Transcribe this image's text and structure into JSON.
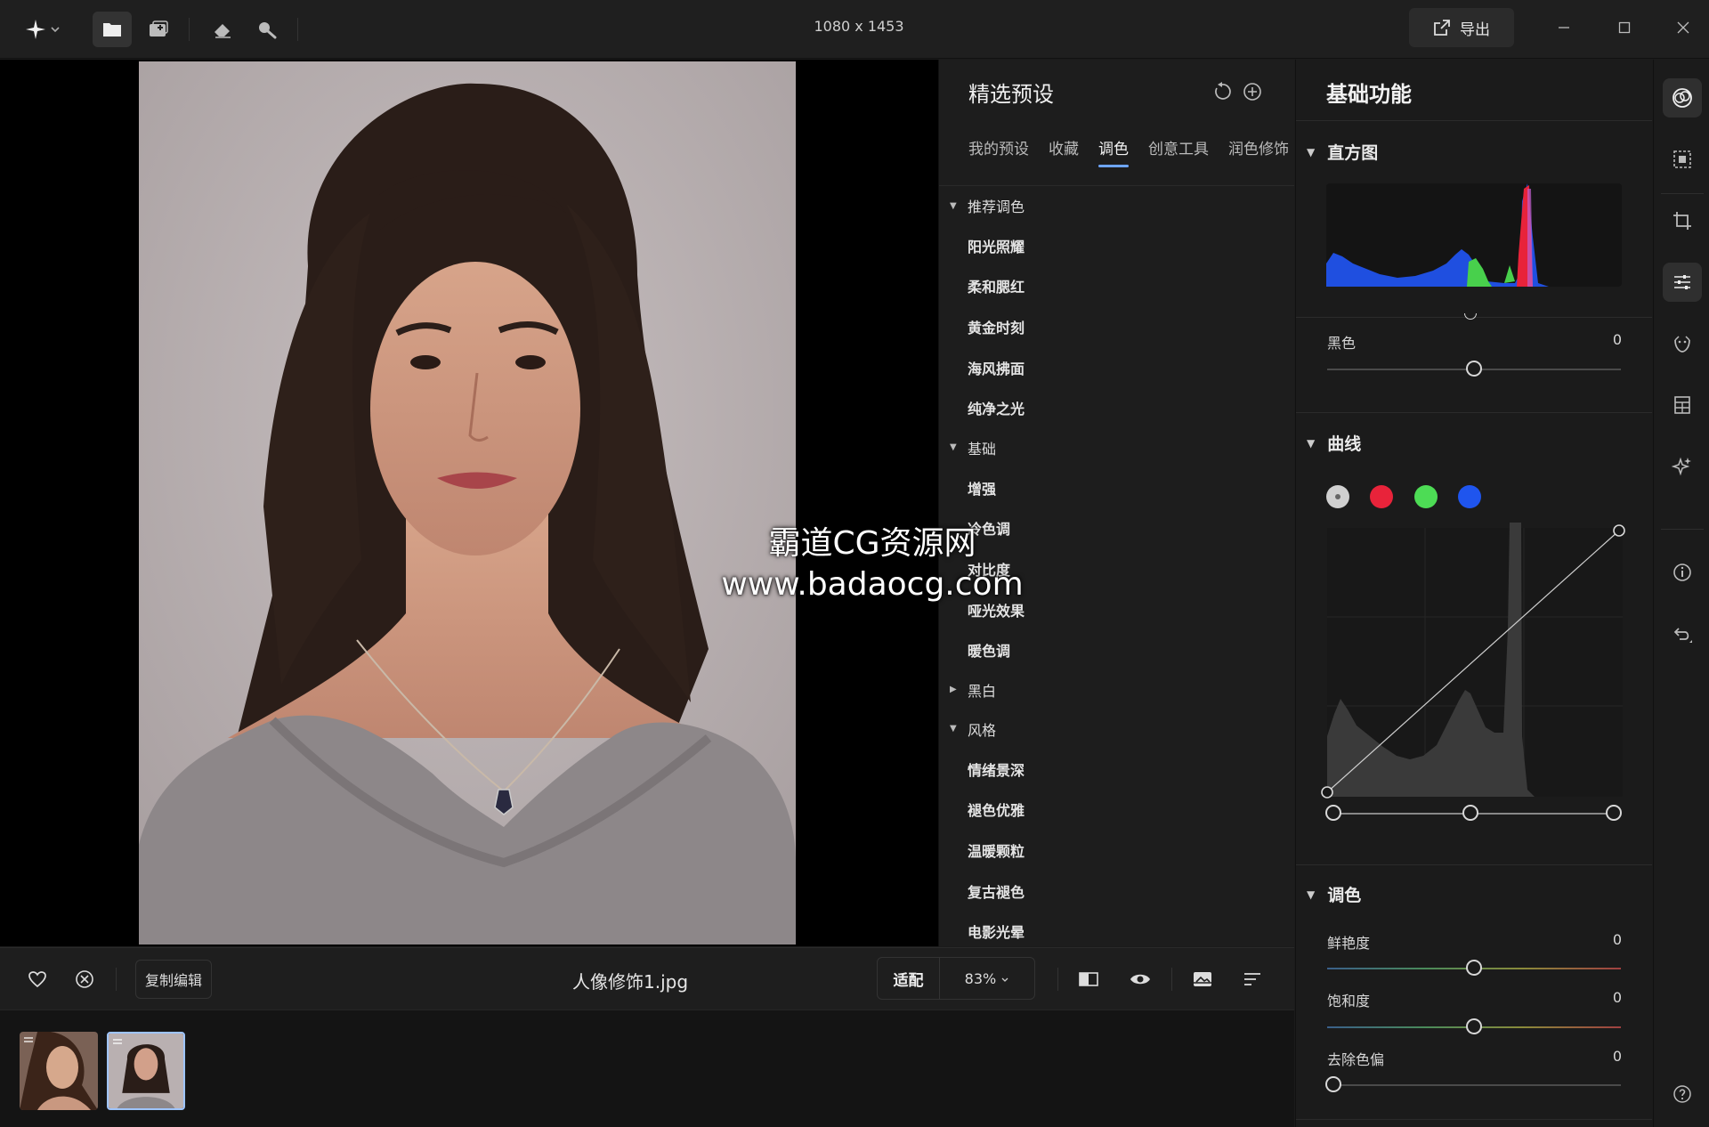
{
  "topbar": {
    "image_dimensions": "1080 x 1453",
    "export_label": "导出"
  },
  "watermark": {
    "line1": "霸道CG资源网",
    "line2": "www.badaocg.com"
  },
  "bottombar": {
    "copy_edit_label": "复制编辑",
    "filename": "人像修饰1.jpg",
    "fit_label": "适配",
    "zoom_value": "83%"
  },
  "preset_panel": {
    "title": "精选预设",
    "tabs": [
      "我的预设",
      "收藏",
      "调色",
      "创意工具",
      "润色修饰"
    ],
    "active_tab": "调色",
    "categories": [
      {
        "label": "推荐调色",
        "expanded": true,
        "items": [
          "阳光照耀",
          "柔和腮红",
          "黄金时刻",
          "海风拂面",
          "纯净之光"
        ]
      },
      {
        "label": "基础",
        "expanded": true,
        "items": [
          "增强",
          "冷色调",
          "对比度",
          "哑光效果",
          "暖色调"
        ]
      },
      {
        "label": "黑白",
        "expanded": false,
        "items": []
      },
      {
        "label": "风格",
        "expanded": true,
        "items": [
          "情绪景深",
          "褪色优雅",
          "温暖颗粒",
          "复古褪色",
          "电影光晕"
        ]
      }
    ]
  },
  "basic_panel": {
    "title": "基础功能",
    "histogram": {
      "label": "直方图"
    },
    "black": {
      "label": "黑色",
      "value": "0"
    },
    "curves": {
      "label": "曲线"
    },
    "color": {
      "label": "调色",
      "vibrance": {
        "label": "鲜艳度",
        "value": "0"
      },
      "saturation": {
        "label": "饱和度",
        "value": "0"
      },
      "dehaze": {
        "label": "去除色偏",
        "value": "0"
      }
    }
  },
  "colors": {
    "accent": "#6ea5ff",
    "curve_white": "#d0d0d0",
    "curve_red": "#e8233a",
    "curve_green": "#4ddc55",
    "curve_blue": "#1f55ee"
  }
}
